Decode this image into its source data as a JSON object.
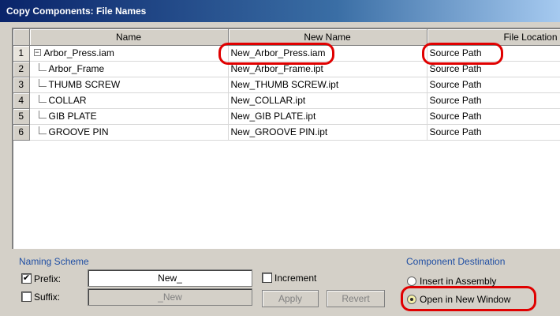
{
  "window": {
    "title": "Copy Components: File Names"
  },
  "grid": {
    "columns": [
      "Name",
      "New Name",
      "File Location"
    ],
    "rows": [
      {
        "num": "1",
        "name": "Arbor_Press.iam",
        "new_name": "New_Arbor_Press.iam",
        "location": "Source Path",
        "expand": "−"
      },
      {
        "num": "2",
        "name": "Arbor_Frame",
        "new_name": "New_Arbor_Frame.ipt",
        "location": "Source Path"
      },
      {
        "num": "3",
        "name": "THUMB SCREW",
        "new_name": "New_THUMB SCREW.ipt",
        "location": "Source Path"
      },
      {
        "num": "4",
        "name": "COLLAR",
        "new_name": "New_COLLAR.ipt",
        "location": "Source Path"
      },
      {
        "num": "5",
        "name": "GIB PLATE",
        "new_name": "New_GIB PLATE.ipt",
        "location": "Source Path"
      },
      {
        "num": "6",
        "name": "GROOVE PIN",
        "new_name": "New_GROOVE PIN.ipt",
        "location": "Source Path"
      }
    ]
  },
  "naming": {
    "title": "Naming Scheme",
    "prefix_label": "Prefix:",
    "prefix_checked": "✔",
    "prefix_value": "New_",
    "suffix_label": "Suffix:",
    "suffix_value": "_New",
    "increment_label": "Increment",
    "apply_label": "Apply",
    "revert_label": "Revert"
  },
  "destination": {
    "title": "Component Destination",
    "option_insert": "Insert in Assembly",
    "option_new_window": "Open in New Window",
    "selected": "Open in New Window"
  },
  "colors": {
    "title_bar": "#0a246a",
    "highlight": "#e00000",
    "group_label": "#1f4ea3"
  }
}
